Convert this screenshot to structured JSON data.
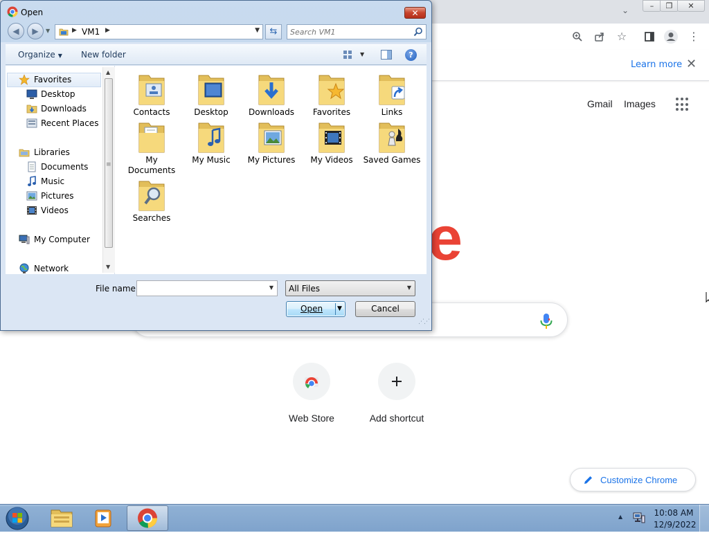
{
  "chrome": {
    "infobar": {
      "learn_more": "Learn more"
    },
    "links": {
      "gmail": "Gmail",
      "images": "Images"
    },
    "logo_fragment": "e",
    "shortcuts": [
      {
        "label": "Web Store",
        "icon": "web-store-icon"
      },
      {
        "label": "Add shortcut",
        "icon": "plus-icon"
      }
    ],
    "customize_label": "Customize Chrome",
    "colors": {
      "accent": "#1a73e8",
      "logo_red": "#ea4335"
    }
  },
  "dialog": {
    "title": "Open",
    "address": {
      "crumb": "VM1"
    },
    "search_placeholder": "Search VM1",
    "toolbar": {
      "organize": "Organize",
      "new_folder": "New folder"
    },
    "nav": {
      "favorites": {
        "label": "Favorites",
        "items": [
          "Desktop",
          "Downloads",
          "Recent Places"
        ]
      },
      "libraries": {
        "label": "Libraries",
        "items": [
          "Documents",
          "Music",
          "Pictures",
          "Videos"
        ]
      },
      "computer": "My Computer",
      "network": "Network"
    },
    "files": [
      {
        "label": "Contacts",
        "icon": "contacts-folder-icon"
      },
      {
        "label": "Desktop",
        "icon": "desktop-folder-icon"
      },
      {
        "label": "Downloads",
        "icon": "downloads-folder-icon"
      },
      {
        "label": "Favorites",
        "icon": "favorites-folder-icon"
      },
      {
        "label": "Links",
        "icon": "links-folder-icon"
      },
      {
        "label": "My Documents",
        "icon": "documents-folder-icon"
      },
      {
        "label": "My Music",
        "icon": "music-folder-icon"
      },
      {
        "label": "My Pictures",
        "icon": "pictures-folder-icon"
      },
      {
        "label": "My Videos",
        "icon": "videos-folder-icon"
      },
      {
        "label": "Saved Games",
        "icon": "saved-games-folder-icon"
      },
      {
        "label": "Searches",
        "icon": "searches-folder-icon"
      }
    ],
    "filename_label": "File name:",
    "filename_value": "",
    "filter_value": "All Files",
    "open_button": "Open",
    "cancel_button": "Cancel"
  },
  "taskbar": {
    "time": "10:08 AM",
    "date": "12/9/2022"
  }
}
